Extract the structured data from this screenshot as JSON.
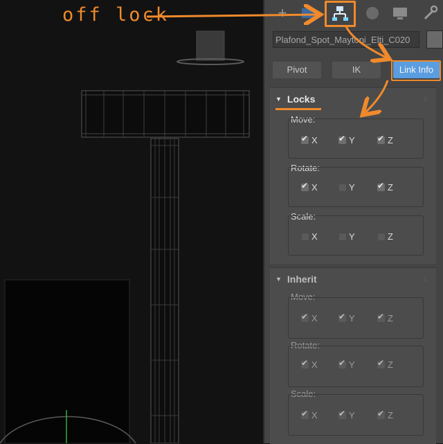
{
  "annotation": {
    "text": "off lock",
    "color": "#f08a2c"
  },
  "object_name": "Plafond_Spot_Maytoni_Elti_C020",
  "tabs": [
    {
      "name": "create-tab",
      "icon": "plus-icon"
    },
    {
      "name": "modify-tab",
      "icon": "modifier-icon"
    },
    {
      "name": "hierarchy-tab",
      "icon": "hierarchy-icon",
      "active": true
    },
    {
      "name": "motion-tab",
      "icon": "sphere-icon"
    },
    {
      "name": "display-tab",
      "icon": "monitor-icon"
    },
    {
      "name": "utilities-tab",
      "icon": "wrench-icon"
    }
  ],
  "subtabs": [
    "Pivot",
    "IK",
    "Link Info"
  ],
  "locks": {
    "title": "Locks",
    "move_label": "Move:",
    "rotate_label": "Rotate:",
    "scale_label": "Scale:",
    "move": {
      "x": true,
      "y": true,
      "z": true
    },
    "rotate": {
      "x": true,
      "y": false,
      "z": true
    },
    "scale": {
      "x": false,
      "y": false,
      "z": false
    }
  },
  "inherit": {
    "title": "Inherit",
    "move_label": "Move:",
    "rotate_label": "Rotate:",
    "scale_label": "Scale:",
    "move": {
      "x": true,
      "y": true,
      "z": true
    },
    "rotate": {
      "x": true,
      "y": true,
      "z": true
    },
    "scale": {
      "x": true,
      "y": true,
      "z": true
    }
  },
  "axis_labels": {
    "x": "X",
    "y": "Y",
    "z": "Z"
  },
  "colors": {
    "accent": "#f08a2c",
    "active_tab": "#5a9de0",
    "panel": "#444444"
  }
}
